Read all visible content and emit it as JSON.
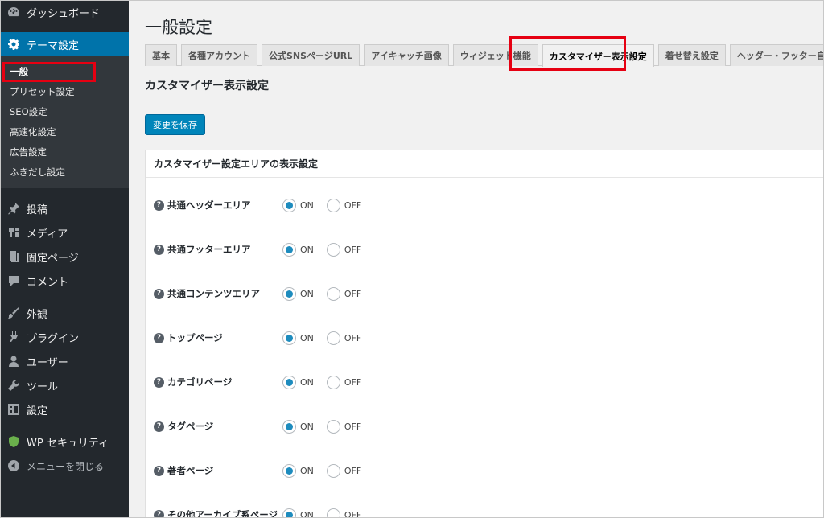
{
  "sidebar": {
    "top_items": [
      {
        "label": "ダッシュボード",
        "icon": "dashboard-icon"
      },
      {
        "label": "テーマ設定",
        "icon": "gear-icon"
      }
    ],
    "submenu": [
      "一般",
      "プリセット設定",
      "SEO設定",
      "高速化設定",
      "広告設定",
      "ふきだし設定"
    ],
    "items": [
      {
        "label": "投稿",
        "icon": "pin-icon"
      },
      {
        "label": "メディア",
        "icon": "media-icon"
      },
      {
        "label": "固定ページ",
        "icon": "page-icon"
      },
      {
        "label": "コメント",
        "icon": "comment-icon"
      },
      {
        "label": "外観",
        "icon": "brush-icon"
      },
      {
        "label": "プラグイン",
        "icon": "plugin-icon"
      },
      {
        "label": "ユーザー",
        "icon": "user-icon"
      },
      {
        "label": "ツール",
        "icon": "wrench-icon"
      },
      {
        "label": "設定",
        "icon": "settings-icon"
      },
      {
        "label": "WP セキュリティ",
        "icon": "shield-icon"
      },
      {
        "label": "メニューを閉じる",
        "icon": "collapse-icon"
      }
    ]
  },
  "main": {
    "title": "一般設定",
    "tabs": [
      "基本",
      "各種アカウント",
      "公式SNSページURL",
      "アイキャッチ画像",
      "ウィジェット機能",
      "カスタマイザー表示設定",
      "着せ替え設定",
      "ヘッダー・フッター自由入力"
    ],
    "active_tab": 5,
    "section_title": "カスタマイザー表示設定",
    "save_label": "変更を保存",
    "panel_title": "カスタマイザー設定エリアの表示設定",
    "on_label": "ON",
    "off_label": "OFF",
    "rows": [
      {
        "label": "共通ヘッダーエリア",
        "selected": "ON"
      },
      {
        "label": "共通フッターエリア",
        "selected": "ON"
      },
      {
        "label": "共通コンテンツエリア",
        "selected": "ON"
      },
      {
        "label": "トップページ",
        "selected": "ON"
      },
      {
        "label": "カテゴリページ",
        "selected": "ON"
      },
      {
        "label": "タグページ",
        "selected": "ON"
      },
      {
        "label": "著者ページ",
        "selected": "ON"
      },
      {
        "label": "その他アーカイブ系ページ",
        "selected": "ON"
      }
    ]
  },
  "colors": {
    "accent": "#0073aa",
    "highlight": "#e60012",
    "sidebar_bg": "#23282d"
  }
}
